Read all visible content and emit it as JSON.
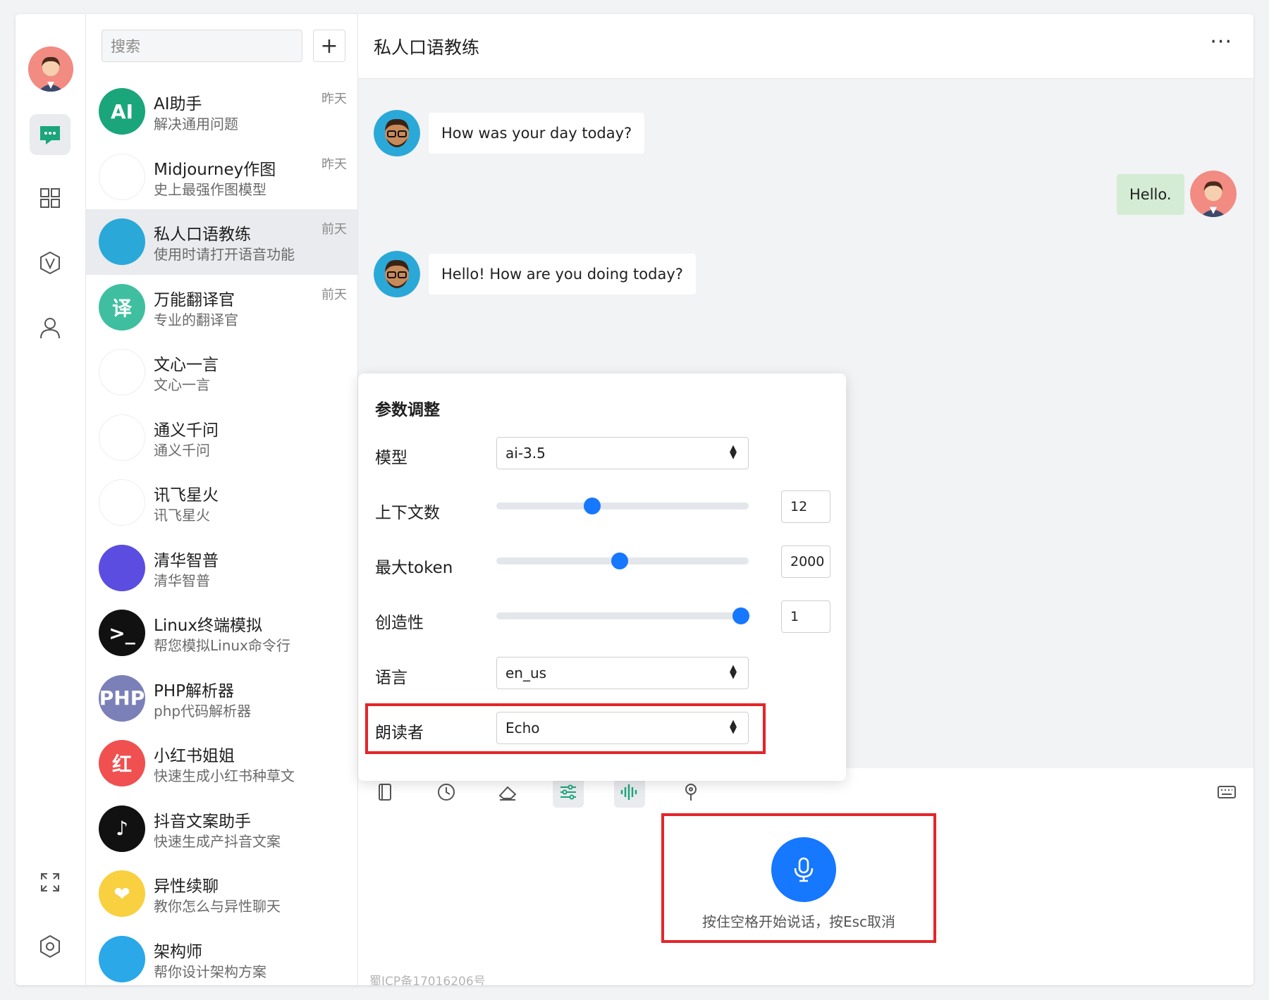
{
  "search": {
    "placeholder": "搜索"
  },
  "add_label": "+",
  "conversations": [
    {
      "name": "AI助手",
      "desc": "解决通用问题",
      "time": "昨天",
      "avatar_text": "AI",
      "color": "#1aa57a"
    },
    {
      "name": "Midjourney作图",
      "desc": "史上最强作图模型",
      "time": "昨天",
      "avatar_text": "",
      "color": "#ffffff"
    },
    {
      "name": "私人口语教练",
      "desc": "使用时请打开语音功能",
      "time": "前天",
      "avatar_text": "",
      "color": "#2aa8d8"
    },
    {
      "name": "万能翻译官",
      "desc": "专业的翻译官",
      "time": "前天",
      "avatar_text": "译",
      "color": "#3fbfa0"
    },
    {
      "name": "文心一言",
      "desc": "文心一言",
      "time": "",
      "avatar_text": "",
      "color": "#ffffff"
    },
    {
      "name": "通义千问",
      "desc": "通义千问",
      "time": "",
      "avatar_text": "",
      "color": "#ffffff"
    },
    {
      "name": "讯飞星火",
      "desc": "讯飞星火",
      "time": "",
      "avatar_text": "",
      "color": "#ffffff"
    },
    {
      "name": "清华智普",
      "desc": "清华智普",
      "time": "",
      "avatar_text": "",
      "color": "#5b4de0"
    },
    {
      "name": "Linux终端模拟",
      "desc": "帮您模拟Linux命令行",
      "time": "",
      "avatar_text": ">_",
      "color": "#111111"
    },
    {
      "name": "PHP解析器",
      "desc": "php代码解析器",
      "time": "",
      "avatar_text": "PHP",
      "color": "#7b80b8"
    },
    {
      "name": "小红书姐姐",
      "desc": "快速生成小红书种草文",
      "time": "",
      "avatar_text": "红",
      "color": "#f05050"
    },
    {
      "name": "抖音文案助手",
      "desc": "快速生成产抖音文案",
      "time": "",
      "avatar_text": "♪",
      "color": "#111111"
    },
    {
      "name": "异性续聊",
      "desc": "教你怎么与异性聊天",
      "time": "",
      "avatar_text": "❤",
      "color": "#f8d040"
    },
    {
      "name": "架构师",
      "desc": "帮你设计架构方案",
      "time": "",
      "avatar_text": "",
      "color": "#2aa8e8"
    }
  ],
  "chat": {
    "title": "私人口语教练",
    "more": "···",
    "messages": [
      {
        "from": "bot",
        "text": "How was your day today?"
      },
      {
        "from": "me",
        "text": "Hello."
      },
      {
        "from": "bot",
        "text": "Hello! How are you doing today?"
      }
    ],
    "voice_hint": "按住空格开始说话，按Esc取消",
    "icp": "蜀ICP备17016206号"
  },
  "params": {
    "title": "参数调整",
    "model": {
      "label": "模型",
      "value": "ai-3.5"
    },
    "context": {
      "label": "上下文数",
      "value": "12",
      "fraction": 0.38
    },
    "max_token": {
      "label": "最大token",
      "value": "2000",
      "fraction": 0.49
    },
    "creativity": {
      "label": "创造性",
      "value": "1",
      "fraction": 0.97
    },
    "language": {
      "label": "语言",
      "value": "en_us"
    },
    "reader": {
      "label": "朗读者",
      "value": "Echo"
    }
  },
  "colors": {
    "accent": "#1677ff",
    "highlight": "#e5242b",
    "green": "#1aa57a",
    "mine_bubble": "#d5ecd4"
  }
}
